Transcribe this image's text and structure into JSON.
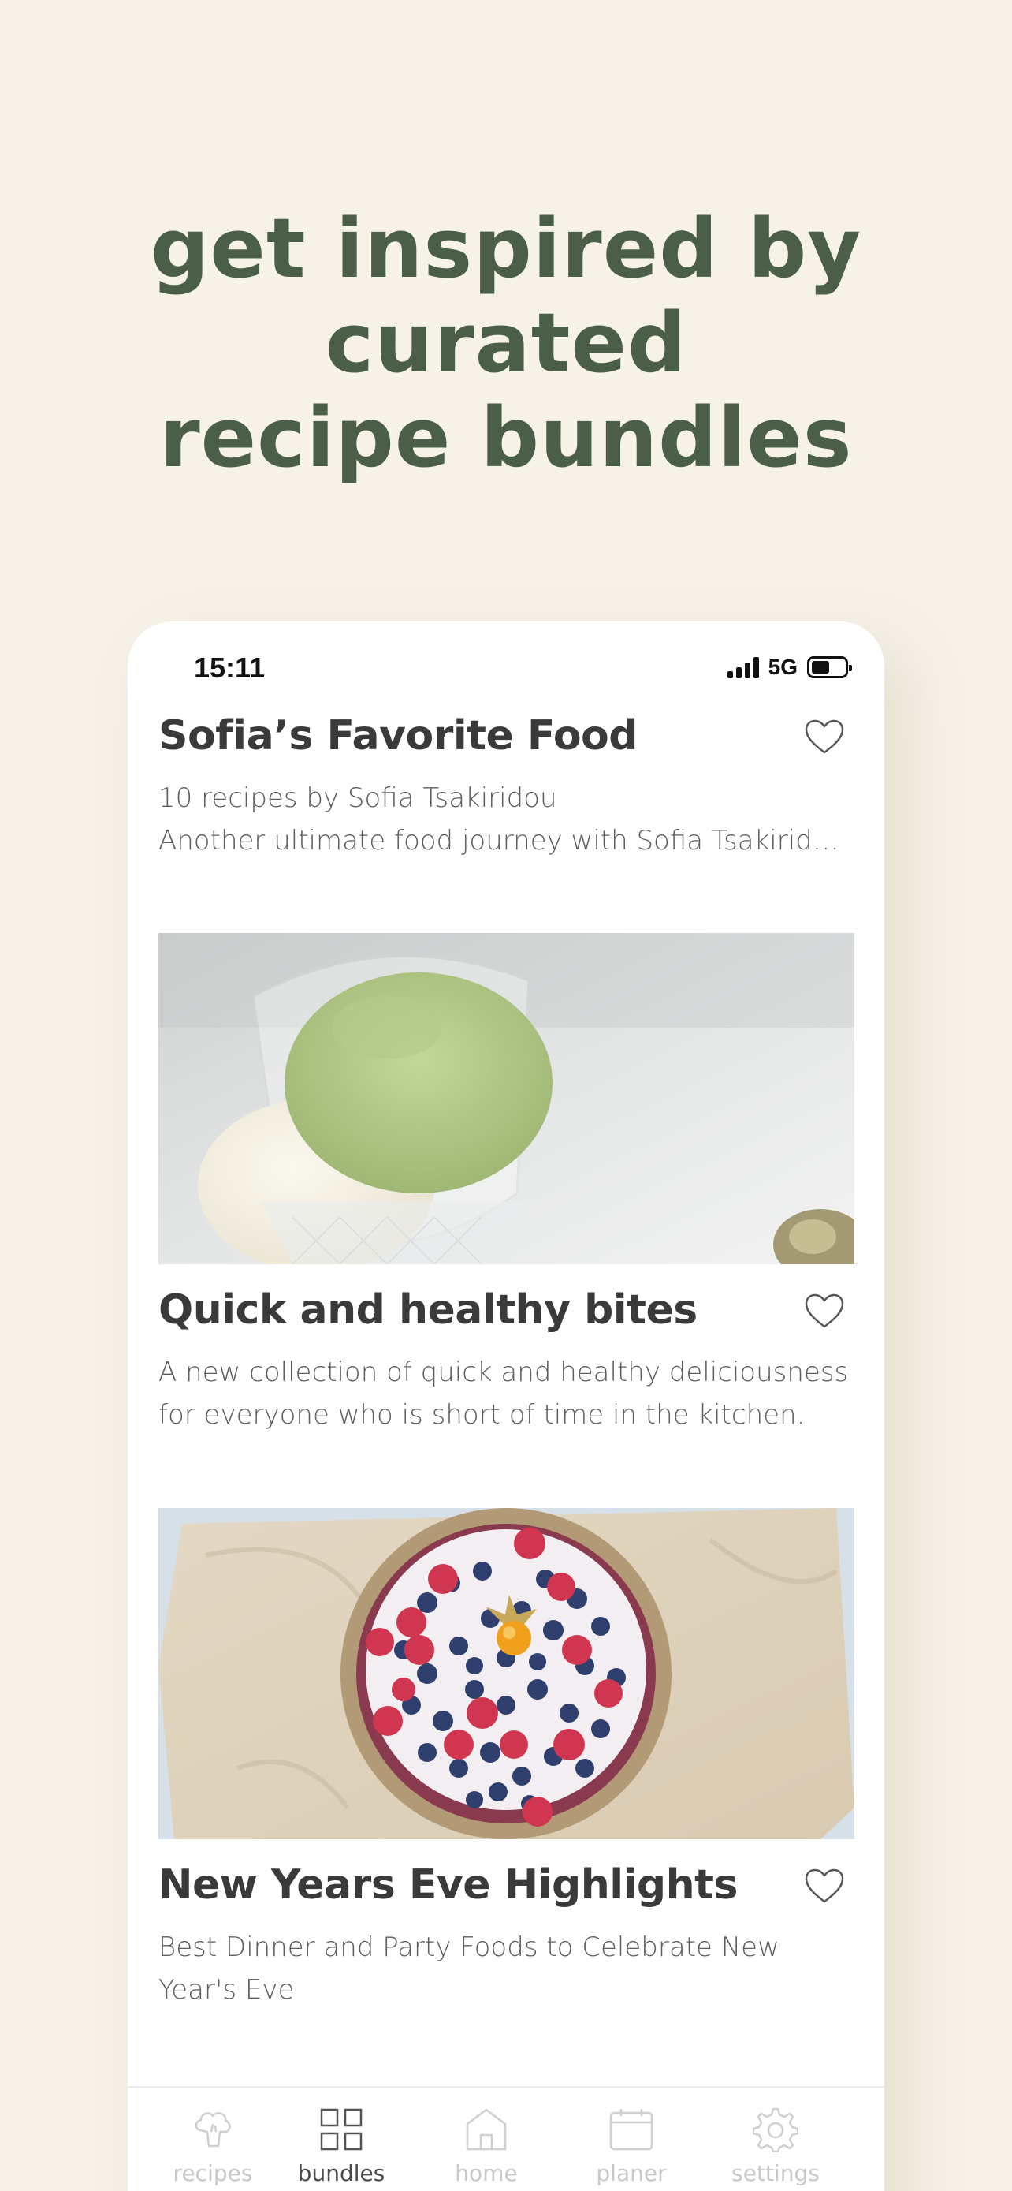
{
  "headline": {
    "line1": "get inspired by",
    "line2": "curated",
    "line3": "recipe bundles"
  },
  "status_bar": {
    "time": "15:11",
    "network": "5G"
  },
  "bundles": [
    {
      "title": "Sofia’s Favorite Food",
      "subtitle": "10 recipes by Sofia Tsakiridou",
      "description": "Another ultimate food journey with Sofia Tsakiridou..."
    },
    {
      "title": "Quick and healthy bites",
      "description_line1": "A new collection of quick and healthy deliciousness",
      "description_line2": "for everyone who is short of time in the kitchen."
    },
    {
      "title": "New Years Eve Highlights",
      "description_line1": "Best Dinner and Party Foods to Celebrate New",
      "description_line2": "Year's Eve"
    }
  ],
  "tabbar": {
    "items": [
      {
        "label": "recipes",
        "icon": "broccoli-icon",
        "active": false
      },
      {
        "label": "bundles",
        "icon": "grid-icon",
        "active": true
      },
      {
        "label": "home",
        "icon": "house-icon",
        "active": false
      },
      {
        "label": "planer",
        "icon": "calendar-icon",
        "active": false
      },
      {
        "label": "settings",
        "icon": "gear-icon",
        "active": false
      }
    ]
  },
  "colors": {
    "background": "#f6f2e8",
    "headline": "#4a5e48",
    "card": "#ffffff",
    "title_text": "#3a3a3a",
    "inactive_tab": "#c8c8c8"
  }
}
